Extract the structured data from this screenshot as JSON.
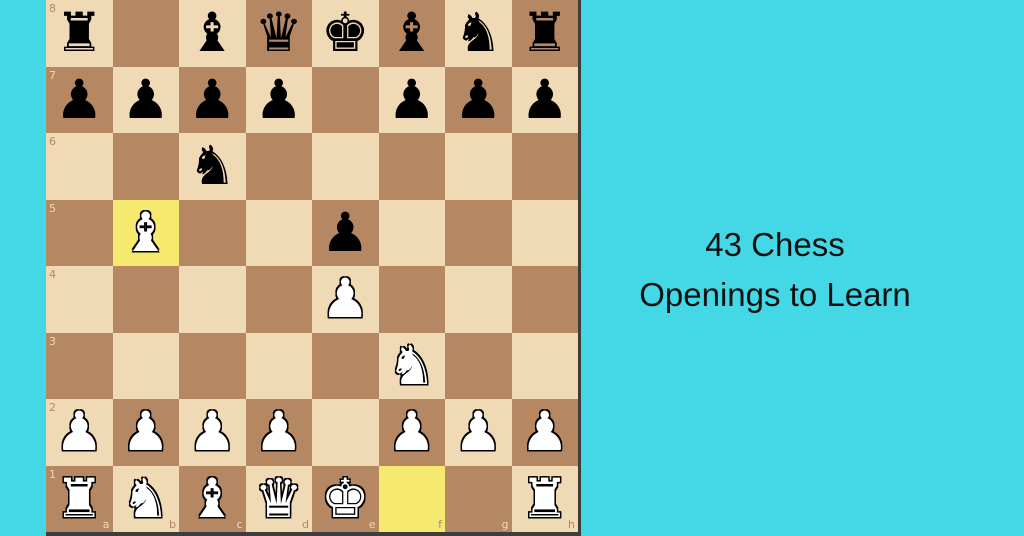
{
  "title": {
    "line1": "43 Chess",
    "line2": "Openings to Learn"
  },
  "colors": {
    "background": "#44d8e6",
    "light_square": "#f0d9b5",
    "dark_square": "#b58863",
    "highlight_square": "#f6e96f"
  },
  "board": {
    "files": [
      "a",
      "b",
      "c",
      "d",
      "e",
      "f",
      "g",
      "h"
    ],
    "ranks": [
      "8",
      "7",
      "6",
      "5",
      "4",
      "3",
      "2",
      "1"
    ],
    "highlighted": [
      "b5",
      "f1"
    ],
    "position": {
      "a8": "bR",
      "c8": "bB",
      "d8": "bQ",
      "e8": "bK",
      "f8": "bB",
      "g8": "bN",
      "h8": "bR",
      "a7": "bP",
      "b7": "bP",
      "c7": "bP",
      "d7": "bP",
      "f7": "bP",
      "g7": "bP",
      "h7": "bP",
      "c6": "bN",
      "b5": "wB",
      "e5": "bP",
      "e4": "wP",
      "f3": "wN",
      "a2": "wP",
      "b2": "wP",
      "c2": "wP",
      "d2": "wP",
      "f2": "wP",
      "g2": "wP",
      "h2": "wP",
      "a1": "wR",
      "b1": "wN",
      "c1": "wB",
      "d1": "wQ",
      "e1": "wK",
      "h1": "wR"
    }
  }
}
